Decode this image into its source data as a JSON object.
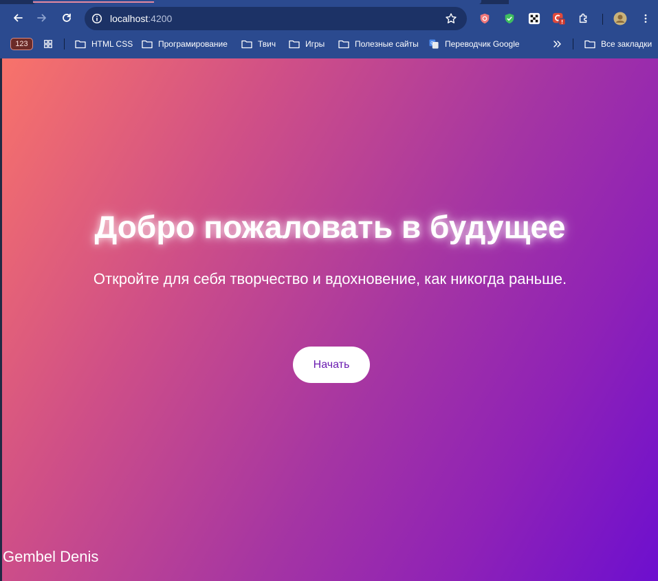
{
  "browser": {
    "url_host": "localhost",
    "url_port": ":4200",
    "bookmarks_badge": "123",
    "bookmarks": [
      {
        "label": "HTML CSS"
      },
      {
        "label": "Програмирование"
      },
      {
        "label": "Твич"
      },
      {
        "label": "Игры"
      },
      {
        "label": "Полезные сайты"
      },
      {
        "label": "Переводчик Google"
      }
    ],
    "all_bookmarks_label": "Все закладки",
    "icons": [
      "back-icon",
      "forward-icon",
      "reload-icon",
      "site-info-icon",
      "star-icon",
      "extension-shield-icon",
      "extension-check-icon",
      "extension-checker-icon",
      "extension-alert-icon",
      "puzzle-icon",
      "avatar",
      "menu-icon",
      "apps-grid-icon",
      "folder-icon",
      "google-translate-icon",
      "chevron-double-right-icon"
    ],
    "colors": {
      "toolbar": "#2b4a8f",
      "omnibox": "#1c3266"
    }
  },
  "page": {
    "title": "Добро пожаловать в будущее",
    "subtitle": "Откройте для себя творчество и вдохновение, как никогда раньше.",
    "cta_label": "Начать",
    "footer_name": "Gembel Denis",
    "colors": {
      "gradient_start": "#f8736a",
      "gradient_end": "#6d0fcf",
      "cta_text": "#6a1bb0"
    }
  }
}
